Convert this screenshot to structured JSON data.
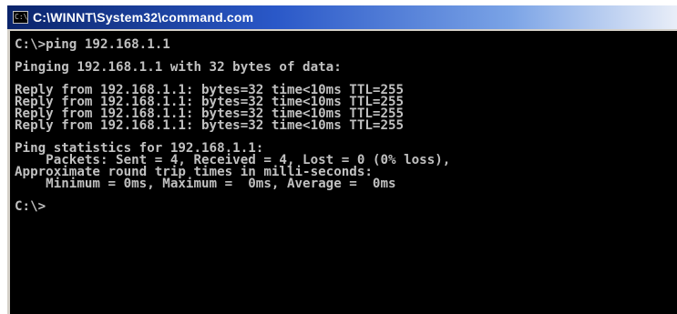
{
  "window": {
    "title": "C:\\WINNT\\System32\\command.com",
    "icon_name": "console-icon",
    "icon_glyph": "C:\\"
  },
  "console": {
    "background": "#000000",
    "foreground": "#c0c0c0",
    "prompt_command": "C:\\>ping 192.168.1.1",
    "pinging_line": "Pinging 192.168.1.1 with 32 bytes of data:",
    "replies": [
      "Reply from 192.168.1.1: bytes=32 time<10ms TTL=255",
      "Reply from 192.168.1.1: bytes=32 time<10ms TTL=255",
      "Reply from 192.168.1.1: bytes=32 time<10ms TTL=255",
      "Reply from 192.168.1.1: bytes=32 time<10ms TTL=255"
    ],
    "stats_header": "Ping statistics for 192.168.1.1:",
    "packets_line": "    Packets: Sent = 4, Received = 4, Lost = 0 (0% loss),",
    "rtt_header": "Approximate round trip times in milli-seconds:",
    "rtt_line": "    Minimum = 0ms, Maximum =  0ms, Average =  0ms",
    "final_prompt": "C:\\>"
  }
}
